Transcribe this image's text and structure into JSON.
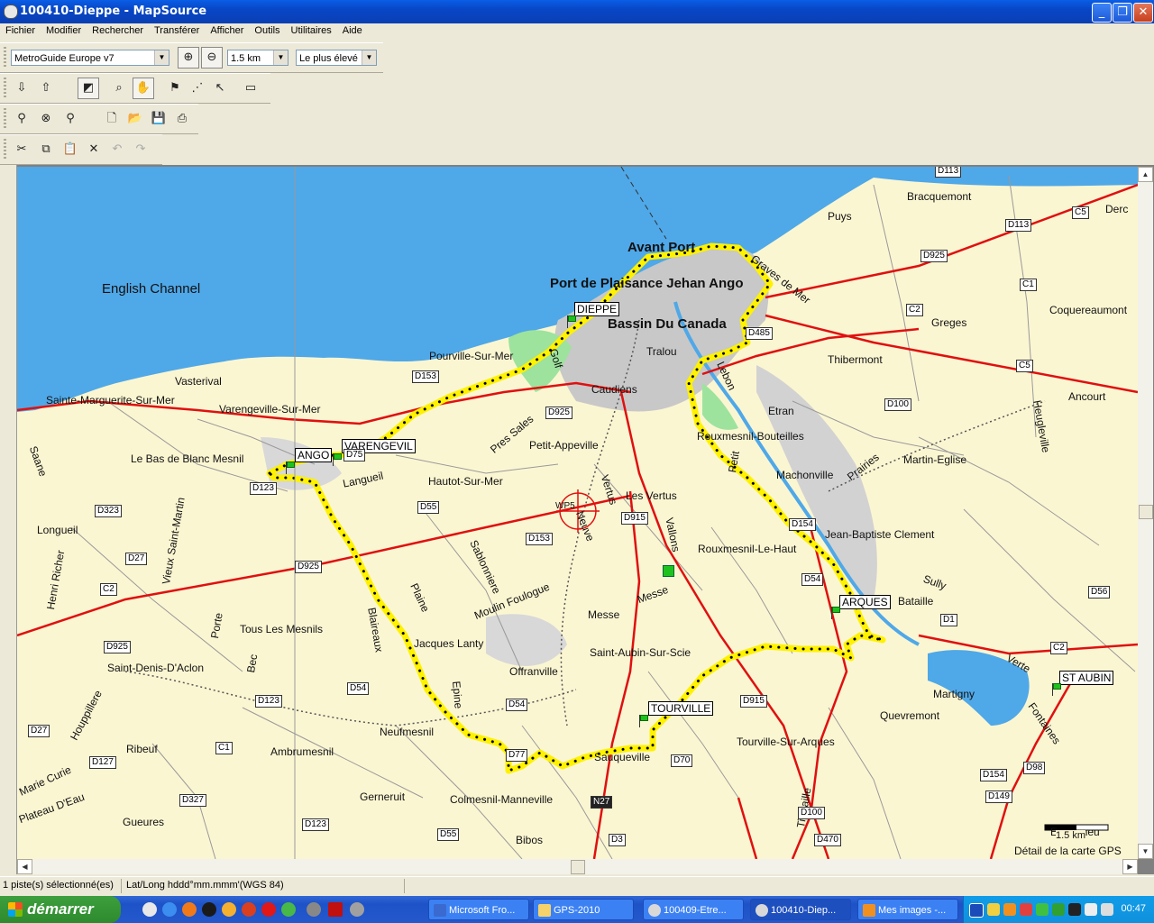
{
  "window": {
    "title": "100410-Dieppe - MapSource",
    "minimize": "_",
    "restore": "❐",
    "close": "✕"
  },
  "menu": [
    "Fichier",
    "Modifier",
    "Rechercher",
    "Transférer",
    "Afficher",
    "Outils",
    "Utilitaires",
    "Aide"
  ],
  "toolbar": {
    "map_product": "MetroGuide Europe v7",
    "zoom_scale": "1.5 km",
    "detail_level": "Le plus élevé"
  },
  "map": {
    "water_label": "English Channel",
    "big_labels": [
      "Avant Port",
      "Port de Plaisance Jehan Ango",
      "Bassin Du Canada"
    ],
    "towns_boxed": [
      "DIEPPE",
      "ANGO",
      "VARENGEVIL",
      "ARQUES",
      "TOURVILLE",
      "ST AUBIN"
    ],
    "places": [
      "Bracquemont",
      "Puys",
      "Graves de Mer",
      "Greges",
      "Coquereaumont",
      "Derc",
      "Thibermont",
      "Ancourt",
      "Etran",
      "Rouxmesnil-Bouteilles",
      "Martin-Eglise",
      "Machonville",
      "Heugleville",
      "Prairies",
      "Jean-Baptiste Clement",
      "Sully",
      "Bataille",
      "Rouxmesnil-Le-Haut",
      "Les Vertus",
      "Vallons",
      "Messe",
      "Messe",
      "Vertus",
      "Neuve",
      "Saint-Aubin-Sur-Scie",
      "Martigny",
      "Quevremont",
      "Fontaines",
      "Verte",
      "Tourville-Sur-Arques",
      "Sauqueville",
      "Colmesnil-Manneville",
      "Bibos",
      "Offranville",
      "Jacques Lanty",
      "Moulin Foulogue",
      "Plaine",
      "Sablonniere",
      "Blaireaux",
      "Neufmesnil",
      "Ambrumesnil",
      "Gerneruit",
      "Gueures",
      "Ribeuf",
      "Hautot-Sur-Mer",
      "Petit-Appeville",
      "Pres Sales",
      "Pourville-Sur-Mer",
      "Caudiens",
      "Tralou",
      "Lebon",
      "Vasterival",
      "Sainte-Marguerite-Sur-Mer",
      "Varengeville-Sur-Mer",
      "Le Bas de Blanc Mesnil",
      "Langueil",
      "Longueil",
      "Henri Richer",
      "Vieux Saint-Martin",
      "Saane",
      "Tous Les Mesnils",
      "Porte",
      "Bec",
      "Saint-Denis-D'Aclon",
      "Houppillere",
      "Marie Curie",
      "Plateau D'Eau",
      "Epine",
      "Golf",
      "Petit",
      "Envermeu",
      "Tiretaille"
    ],
    "roads": [
      "D113",
      "D113",
      "C5",
      "D925",
      "C1",
      "C2",
      "C5",
      "D100",
      "D485",
      "D153",
      "D925",
      "D75",
      "D123",
      "D55",
      "D323",
      "D27",
      "C2",
      "D925",
      "D925",
      "D153",
      "D915",
      "D154",
      "D54",
      "D1",
      "D56",
      "C2",
      "D54",
      "D54",
      "D123",
      "D27",
      "C1",
      "D127",
      "D327",
      "D123",
      "D55",
      "D77",
      "N27",
      "D3",
      "D70",
      "D915",
      "D100",
      "D470",
      "D154",
      "D98",
      "D149"
    ],
    "waypoint_label": "WP5",
    "scale_label": "1.5 km",
    "detail_label": "Détail de la carte GPS"
  },
  "status": {
    "selection": "1 piste(s) sélectionné(es)",
    "coord_format": "Lat/Long hddd°mm.mmm'(WGS 84)"
  },
  "taskbar": {
    "start": "démarrer",
    "tasks": [
      "Microsoft Fro...",
      "GPS-2010",
      "100409-Etre...",
      "100410-Diep...",
      "Mes images -..."
    ],
    "clock": "00:47"
  },
  "colors": {
    "sea": "#4fa8e8",
    "land": "#fbf6d2",
    "urban": "#c8c8c8",
    "major_road": "#e01010",
    "track": "#fff200",
    "park": "#9de39d"
  }
}
